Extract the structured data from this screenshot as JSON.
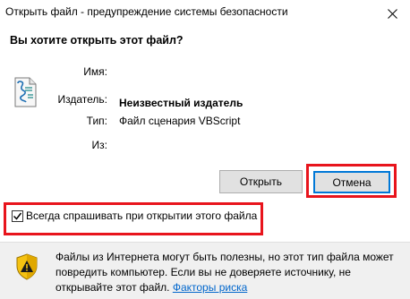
{
  "window": {
    "title": "Открыть файл - предупреждение системы безопасности"
  },
  "question": "Вы хотите открыть этот файл?",
  "fields": {
    "name_label": "Имя:",
    "name_value": "",
    "publisher_label": "Издатель:",
    "publisher_value": "Неизвестный издатель",
    "type_label": "Тип:",
    "type_value": "Файл сценария VBScript",
    "from_label": "Из:",
    "from_value": ""
  },
  "buttons": {
    "open_label": "Открыть",
    "cancel_label": "Отмена"
  },
  "checkbox": {
    "label": "Всегда спрашивать при открытии этого файла",
    "checked": true
  },
  "warning": {
    "text": "Файлы из Интернета могут быть полезны, но этот тип файла может повредить компьютер. Если вы не доверяете источнику, не открывайте этот файл.",
    "link_label": "Факторы риска"
  },
  "colors": {
    "highlight": "#e8141c",
    "accent": "#0078d7",
    "link": "#0066cc"
  },
  "icons": {
    "file": "vbscript-file-icon",
    "shield": "warning-shield-icon",
    "close": "close-icon"
  }
}
